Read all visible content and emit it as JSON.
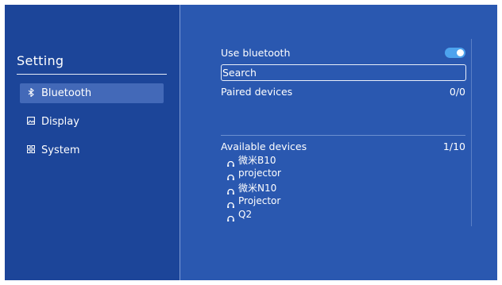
{
  "sidebar": {
    "title": "Setting",
    "items": [
      {
        "icon": "bluetooth-icon",
        "label": "Bluetooth",
        "active": true
      },
      {
        "icon": "display-icon",
        "label": "Display",
        "active": false
      },
      {
        "icon": "system-icon",
        "label": "System",
        "active": false
      }
    ]
  },
  "bluetooth": {
    "use_label": "Use bluetooth",
    "enabled": true,
    "search_label": "Search",
    "paired_label": "Paired devices",
    "paired_count": "0/0",
    "available_label": "Available devices",
    "available_count": "1/10",
    "available_devices": [
      {
        "icon": "headphones-icon",
        "name": "微米B10"
      },
      {
        "icon": "headphones-icon",
        "name": "projector"
      },
      {
        "icon": "headphones-icon",
        "name": "微米N10"
      },
      {
        "icon": "headphones-icon",
        "name": "Projector"
      },
      {
        "icon": "headphones-icon",
        "name": "Q2"
      }
    ]
  },
  "colors": {
    "sidebar_bg": "#1c4599",
    "main_bg": "#2a58b0",
    "active_item_bg": "#4369b8",
    "toggle_on": "#4da3ee"
  }
}
